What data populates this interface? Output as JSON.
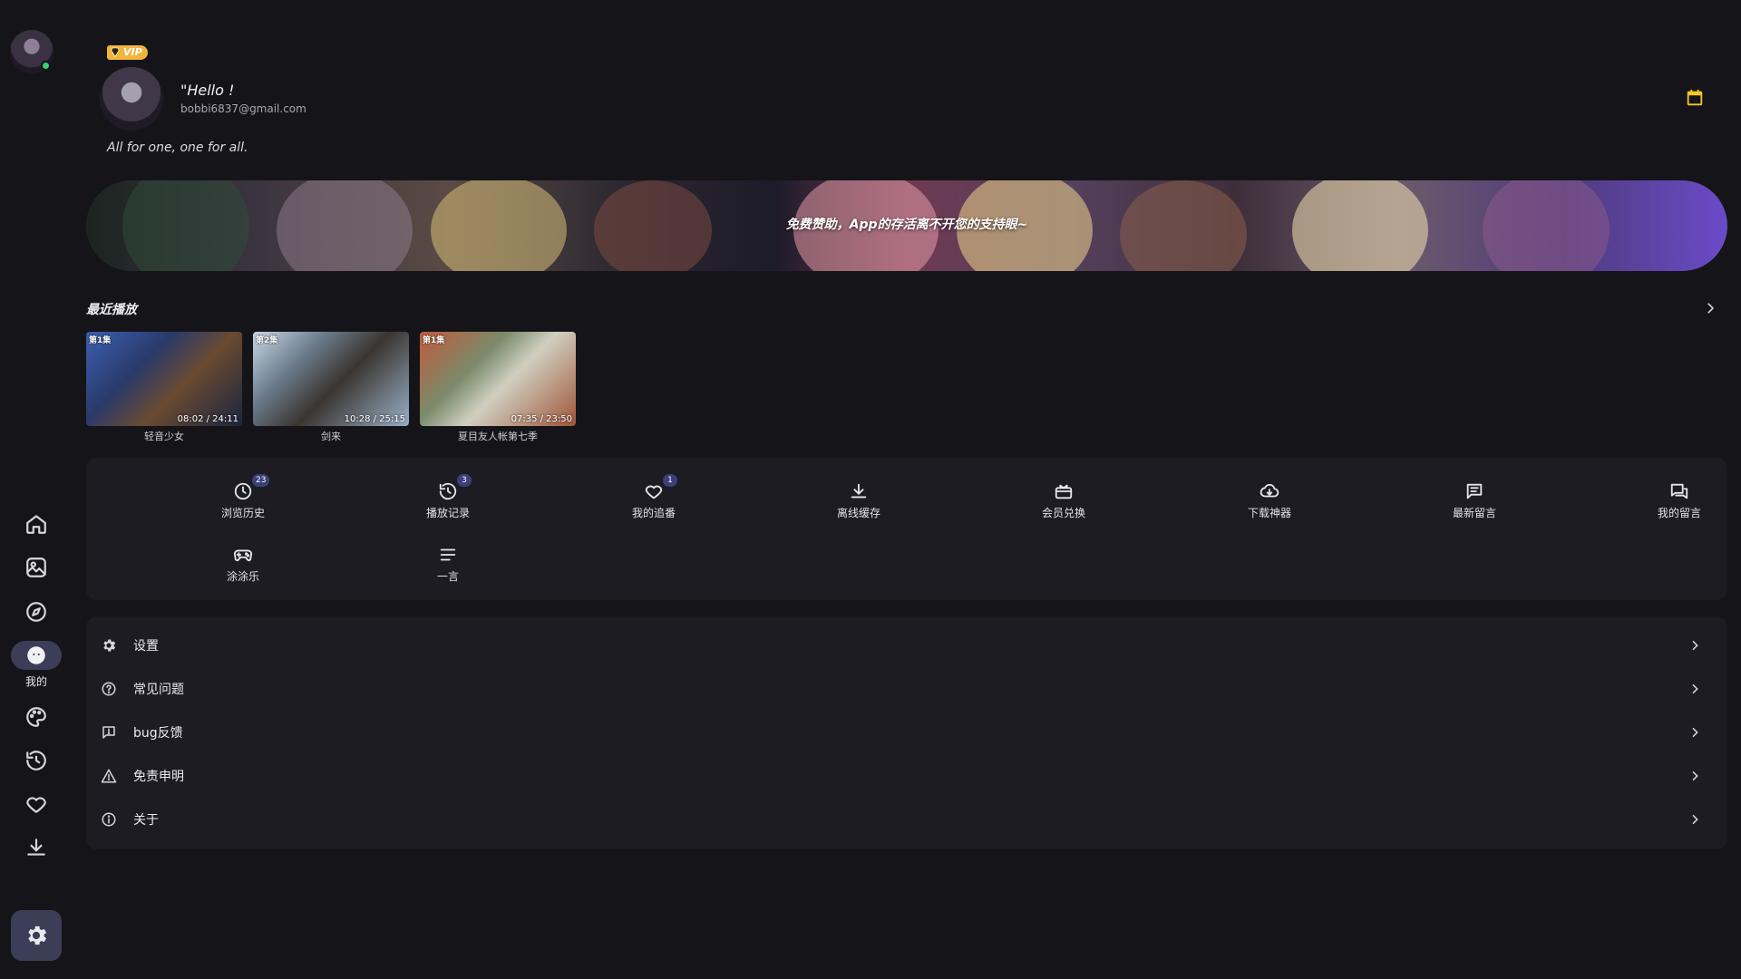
{
  "profile": {
    "vip_label": "VIP",
    "greeting": "\"Hello !",
    "email": "bobbi6837@gmail.com",
    "motto": "All for one, one for all."
  },
  "banner": {
    "text": "免费赞助，App的存活离不开您的支持眼~"
  },
  "nav": {
    "active_label": "我的",
    "items": [
      "home-icon",
      "gallery-icon",
      "compass-icon",
      "profile-icon",
      "palette-icon",
      "history-icon",
      "heart-icon",
      "download-icon"
    ]
  },
  "recent": {
    "title": "最近播放",
    "items": [
      {
        "episode": "第1集",
        "time": "08:02 / 24:11",
        "title": "轻音少女"
      },
      {
        "episode": "第2集",
        "time": "10:28 / 25:15",
        "title": "剑来"
      },
      {
        "episode": "第1集",
        "time": "07:35 / 23:50",
        "title": "夏目友人帐第七季"
      }
    ]
  },
  "features": {
    "items": [
      {
        "label": "浏览历史",
        "badge": "23",
        "icon": "clock-icon"
      },
      {
        "label": "播放记录",
        "badge": "3",
        "icon": "history-icon"
      },
      {
        "label": "我的追番",
        "badge": "1",
        "icon": "heart-icon"
      },
      {
        "label": "离线缓存",
        "badge": "",
        "icon": "download-icon"
      },
      {
        "label": "会员兑换",
        "badge": "",
        "icon": "gift-card-icon"
      },
      {
        "label": "下载神器",
        "badge": "",
        "icon": "cloud-download-icon"
      },
      {
        "label": "最新留言",
        "badge": "",
        "icon": "message-icon"
      },
      {
        "label": "我的留言",
        "badge": "",
        "icon": "chat-icon"
      },
      {
        "label": "涂涂乐",
        "badge": "",
        "icon": "gamepad-icon"
      },
      {
        "label": "一言",
        "badge": "",
        "icon": "lines-icon"
      }
    ]
  },
  "settings_list": {
    "items": [
      {
        "label": "设置",
        "icon": "gear-icon"
      },
      {
        "label": "常见问题",
        "icon": "help-icon"
      },
      {
        "label": "bug反馈",
        "icon": "feedback-icon"
      },
      {
        "label": "免责申明",
        "icon": "warning-icon"
      },
      {
        "label": "关于",
        "icon": "info-icon"
      }
    ]
  },
  "colors": {
    "background": "#151519",
    "card": "#1c1c22",
    "accent_pill": "#3c3d57",
    "vip": "#f3b43a",
    "calendar": "#f3c62c",
    "online": "#3ccf6e",
    "badge": "#3b3f7a"
  }
}
